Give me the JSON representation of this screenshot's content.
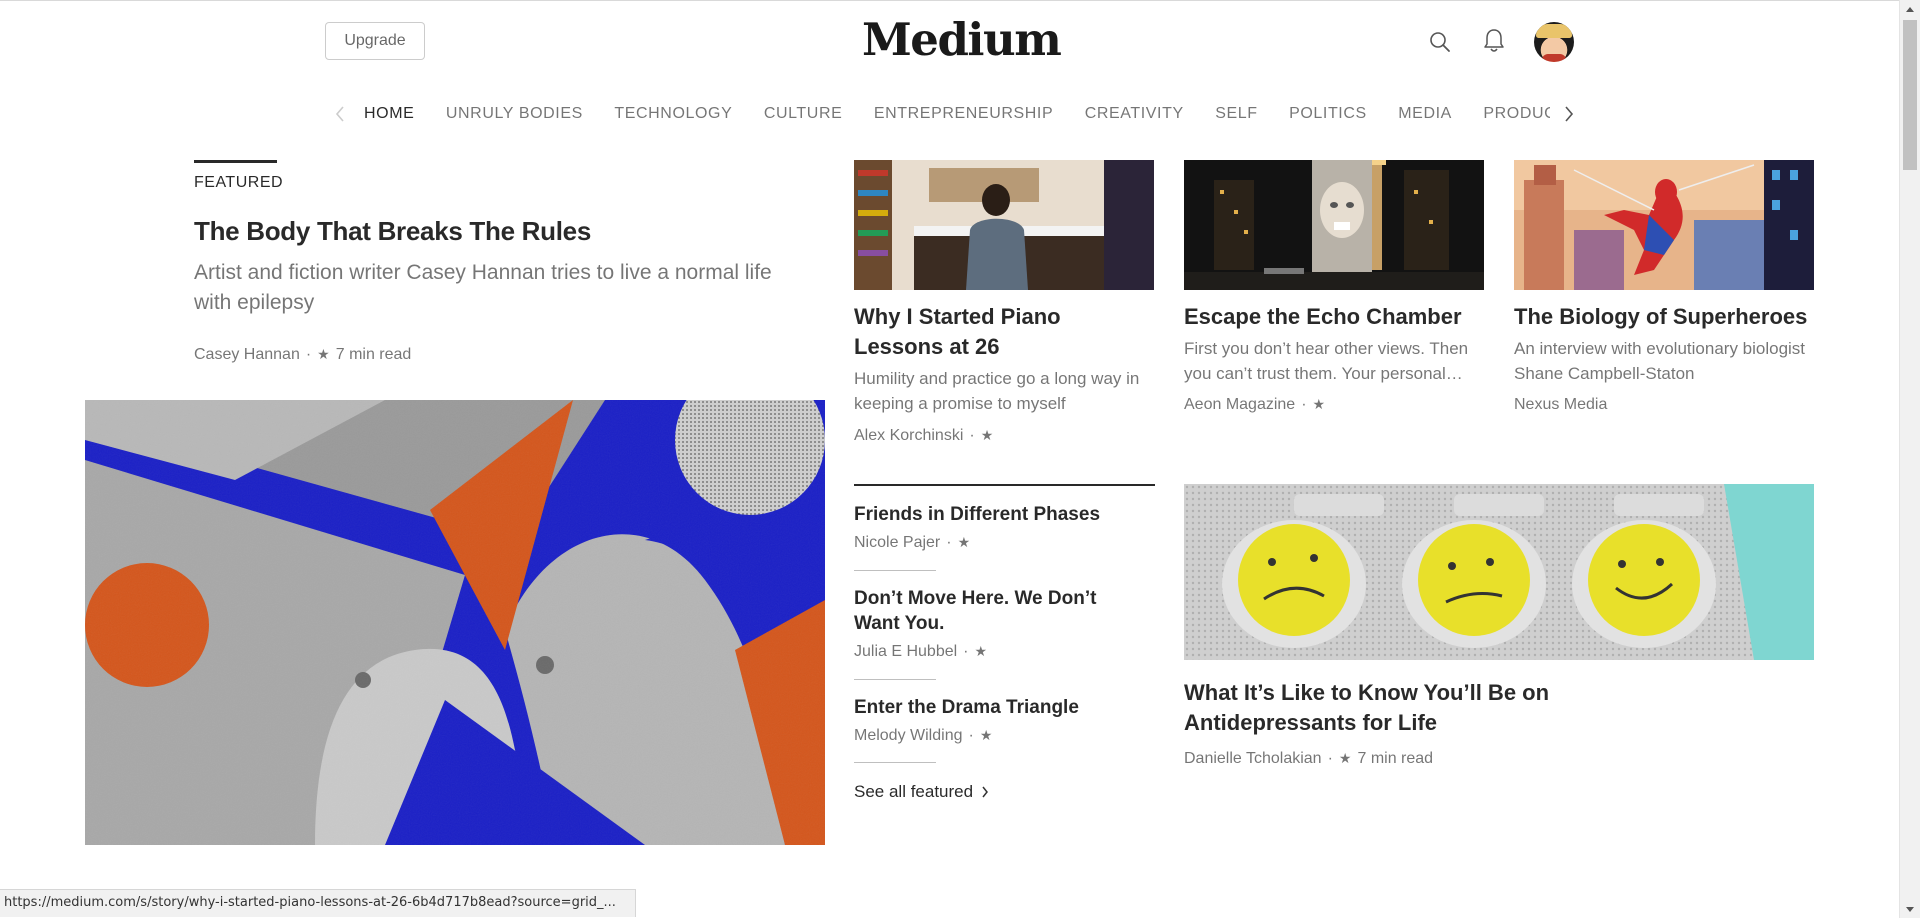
{
  "header": {
    "upgrade_label": "Upgrade",
    "logo_text": "Medium"
  },
  "nav": {
    "items": [
      "HOME",
      "UNRULY BODIES",
      "TECHNOLOGY",
      "CULTURE",
      "ENTREPRENEURSHIP",
      "CREATIVITY",
      "SELF",
      "POLITICS",
      "MEDIA",
      "PRODUCTIVITY"
    ],
    "active": "HOME"
  },
  "featured": {
    "label": "FEATURED",
    "title": "The Body That Breaks The Rules",
    "subtitle": "Artist and fiction writer Casey Hannan tries to live a normal life with epilepsy",
    "author": "Casey Hannan",
    "read_time": "7 min read"
  },
  "cards": [
    {
      "title": "Why I Started Piano Lessons at 26",
      "subtitle": "Humility and practice go a long way in keeping a promise to myself",
      "author": "Alex Korchinski"
    },
    {
      "title": "Escape the Echo Chamber",
      "subtitle": "First you don’t hear other views. Then you can’t trust them. Your personal…",
      "author": "Aeon Magazine"
    },
    {
      "title": "The Biology of Superheroes",
      "subtitle": "An interview with evolutionary biologist Shane Campbell-Staton",
      "author": "Nexus Media"
    }
  ],
  "list": [
    {
      "title": "Friends in Different Phases",
      "author": "Nicole Pajer"
    },
    {
      "title": "Don’t Move Here. We Don’t Want You.",
      "author": "Julia E Hubbel"
    },
    {
      "title": "Enter the Drama Triangle",
      "author": "Melody Wilding"
    }
  ],
  "see_all_label": "See all featured",
  "wide_card": {
    "title": "What It’s Like to Know You’ll Be on Antidepressants for Life",
    "author": "Danielle Tcholakian",
    "read_time": "7 min read"
  },
  "symbols": {
    "star": "★",
    "dot": "·"
  },
  "status_url": "https://medium.com/s/story/why-i-started-piano-lessons-at-26-6b4d717b8ead?source=grid_...",
  "colors": {
    "hero_blue": "#1a1fc6",
    "hero_orange": "#d4561c",
    "text": "rgba(0,0,0,0.84)",
    "muted": "rgba(0,0,0,0.54)"
  }
}
